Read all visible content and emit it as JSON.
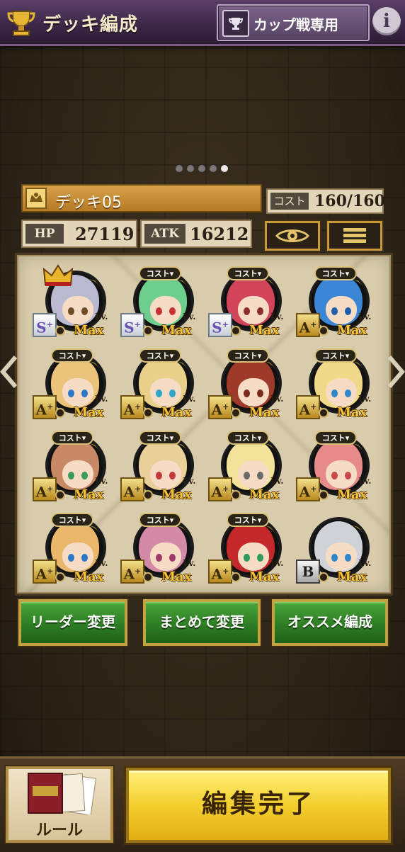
{
  "header": {
    "title": "デッキ編成",
    "cup_badge_label": "カップ戦専用",
    "info_label": "i"
  },
  "pager": {
    "count": 5,
    "active_index": 4
  },
  "deck": {
    "name": "デッキ05",
    "cost_label": "コスト",
    "cost_value": "160/160",
    "hp_label": "HP",
    "hp_value": "27119",
    "atk_label": "ATK",
    "atk_value": "16212"
  },
  "card_labels": {
    "cost_tag": "コスト▾",
    "level": "Lv.",
    "max": "Max"
  },
  "cards": [
    {
      "rarity": "S",
      "leader": true,
      "hair": "#b9b9cf",
      "eyes": "#6d4b2a"
    },
    {
      "rarity": "S",
      "leader": false,
      "hair": "#6ecf8c",
      "eyes": "#c53030"
    },
    {
      "rarity": "S",
      "leader": false,
      "hair": "#d2445a",
      "eyes": "#8a2d2d"
    },
    {
      "rarity": "A",
      "leader": false,
      "hair": "#3c86d6",
      "eyes": "#1f5ea8"
    },
    {
      "rarity": "A",
      "leader": false,
      "hair": "#e9c47a",
      "eyes": "#2f78c8"
    },
    {
      "rarity": "A",
      "leader": false,
      "hair": "#e8cf8a",
      "eyes": "#2fa6c8"
    },
    {
      "rarity": "A",
      "leader": false,
      "hair": "#9e3a2a",
      "eyes": "#7a2a1a"
    },
    {
      "rarity": "A",
      "leader": false,
      "hair": "#f1d98a",
      "eyes": "#2f86c8"
    },
    {
      "rarity": "A",
      "leader": false,
      "hair": "#c88a66",
      "eyes": "#3a9a5a"
    },
    {
      "rarity": "A",
      "leader": false,
      "hair": "#e9cf9a",
      "eyes": "#c23a3a"
    },
    {
      "rarity": "A",
      "leader": false,
      "hair": "#f3e39a",
      "eyes": "#6a6a6a"
    },
    {
      "rarity": "A",
      "leader": false,
      "hair": "#e78a8a",
      "eyes": "#c84a4a"
    },
    {
      "rarity": "A",
      "leader": false,
      "hair": "#e9b66a",
      "eyes": "#2f78c8"
    },
    {
      "rarity": "A",
      "leader": false,
      "hair": "#d28aa6",
      "eyes": "#a03a6a"
    },
    {
      "rarity": "A",
      "leader": false,
      "hair": "#c4282a",
      "eyes": "#2f9a5a"
    },
    {
      "rarity": "B",
      "leader": false,
      "hair": "#cfd3d8",
      "eyes": "#2f86c8",
      "no_cost_tag": true
    }
  ],
  "actions": {
    "leader_change": "リーダー変更",
    "bulk_change": "まとめて変更",
    "recommended": "オススメ編成"
  },
  "footer": {
    "rule_label": "ルール",
    "done_label": "編集完了"
  },
  "colors": {
    "header_bg": "#3c2746",
    "panel_bg": "#d8ccac",
    "green_button": "#2e7d24",
    "gold_button": "#f3cf2e"
  },
  "icons": [
    "trophy-icon",
    "cup-icon",
    "info-icon",
    "eye-icon",
    "menu-icon",
    "crown-icon",
    "arrow-left-icon",
    "arrow-right-icon",
    "rule-book-icon"
  ]
}
